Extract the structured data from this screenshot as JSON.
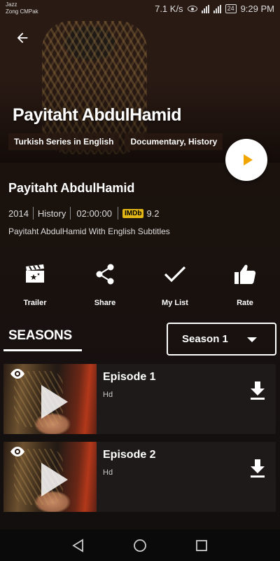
{
  "status_bar": {
    "carrier_line1": "Jazz",
    "carrier_line2": "Zong CMPak",
    "net_speed": "7.1 K/s",
    "battery": "24",
    "time": "9:29 PM"
  },
  "hero": {
    "title": "Payitaht AbdulHamid",
    "tags": [
      "Turkish Series in English",
      "Documentary, History"
    ]
  },
  "info": {
    "title": "Payitaht AbdulHamid",
    "year": "2014",
    "genre": "History",
    "duration": "02:00:00",
    "imdb_badge": "IMDb",
    "rating": "9.2",
    "description": "Payitaht AbdulHamid With English Subtitles"
  },
  "actions": [
    {
      "label": "Trailer",
      "icon": "clapperboard-icon"
    },
    {
      "label": "Share",
      "icon": "share-icon"
    },
    {
      "label": "My List",
      "icon": "checkmark-icon"
    },
    {
      "label": "Rate",
      "icon": "thumbs-up-icon"
    }
  ],
  "seasons": {
    "label": "SEASONS",
    "selected": "Season 1"
  },
  "episodes": [
    {
      "title": "Episode 1",
      "quality": "Hd"
    },
    {
      "title": "Episode 2",
      "quality": "Hd"
    }
  ],
  "colors": {
    "accent": "#f0a500",
    "imdb": "#e2b616",
    "card": "#1d1a19"
  }
}
